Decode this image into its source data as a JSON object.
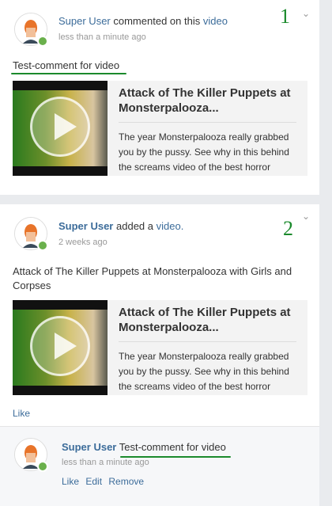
{
  "post1": {
    "author": "Super User",
    "action": "commented on this",
    "object": "video",
    "time": "less than a minute ago",
    "number": "1",
    "comment": "Test-comment for video",
    "attachment": {
      "title": "Attack of The Killer Puppets at Monsterpalooza...",
      "description": "The year Monsterpalooza really grabbed you by the pussy. See why in this behind the screams video of the best horror"
    }
  },
  "post2": {
    "author": "Super User",
    "action": "added a",
    "object": "video.",
    "time": "2 weeks ago",
    "number": "2",
    "text": "Attack of The Killer Puppets at Monsterpalooza with Girls and Corpses",
    "attachment": {
      "title": "Attack of The Killer Puppets at Monsterpalooza...",
      "description": "The year Monsterpalooza really grabbed you by the pussy. See why in this behind the screams video of the best horror"
    },
    "like_label": "Like",
    "comment": {
      "author": "Super User",
      "text": "Test-comment for video",
      "time": "less than a minute ago",
      "actions": {
        "like": "Like",
        "edit": "Edit",
        "remove": "Remove"
      }
    }
  },
  "icons": {
    "chevron": "chevron-down-icon",
    "avatar": "user-avatar",
    "play": "play-icon"
  },
  "colors": {
    "link": "#3c6c9a",
    "annotation": "#1b8a2c",
    "online": "#6ab04c"
  }
}
